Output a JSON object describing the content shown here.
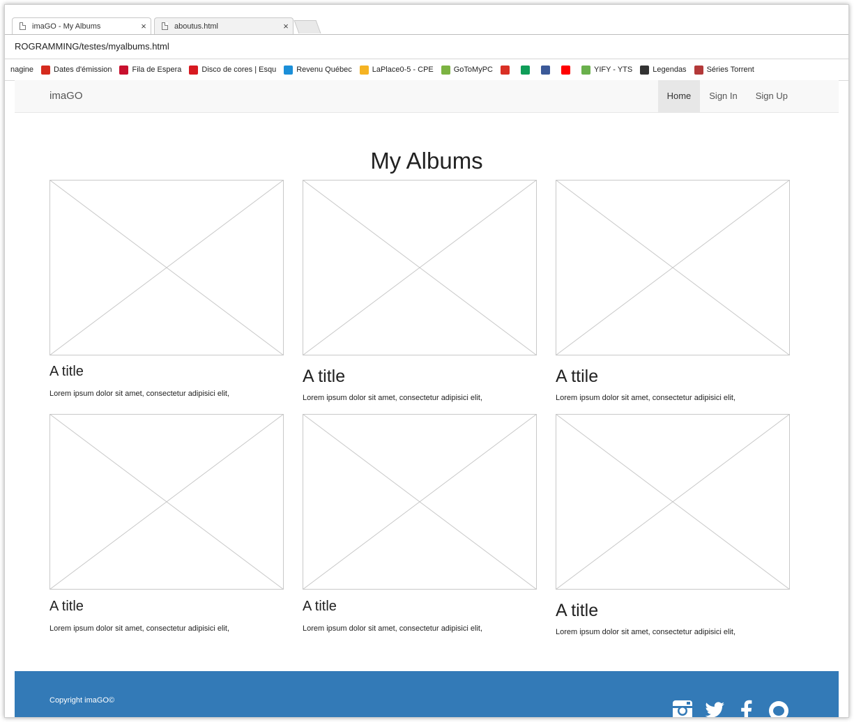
{
  "browser": {
    "tabs": [
      {
        "label": "imaGO - My Albums",
        "close": "×"
      },
      {
        "label": "aboutus.html",
        "close": "×"
      }
    ],
    "address": "ROGRAMMING/testes/myalbums.html",
    "bookmarks": [
      {
        "label": "nagine",
        "color": "#ffffff"
      },
      {
        "label": "Dates d'émission",
        "color": "#d52b1e"
      },
      {
        "label": "Fila de Espera",
        "color": "#c8102e"
      },
      {
        "label": "Disco de cores | Esqu",
        "color": "#d71920"
      },
      {
        "label": "Revenu Québec",
        "color": "#1b8fd8"
      },
      {
        "label": "LaPlace0-5 - CPE",
        "color": "#f5b323"
      },
      {
        "label": "GoToMyPC",
        "color": "#7cb342"
      },
      {
        "label": "",
        "color": "#d93025"
      },
      {
        "label": "",
        "color": "#0f9d58"
      },
      {
        "label": "",
        "color": "#3b5998"
      },
      {
        "label": "",
        "color": "#ff0000"
      },
      {
        "label": "YIFY - YTS",
        "color": "#6ab04c"
      },
      {
        "label": "Legendas",
        "color": "#333333"
      },
      {
        "label": "Séries Torrent",
        "color": "#b33939"
      }
    ]
  },
  "nav": {
    "brand": "imaGO",
    "links": [
      "Home",
      "Sign In",
      "Sign Up"
    ]
  },
  "main": {
    "title": "My Albums",
    "albums": [
      {
        "title": "A title",
        "text": "Lorem ipsum dolor sit amet, consectetur adipisici elit,"
      },
      {
        "title": "A title",
        "text": "Lorem ipsum dolor sit amet, consectetur adipisici elit,"
      },
      {
        "title": "A ttile",
        "text": "Lorem ipsum dolor sit amet, consectetur adipisici elit,"
      },
      {
        "title": "A title",
        "text": "Lorem ipsum dolor sit amet, consectetur adipisici elit,"
      },
      {
        "title": "A title",
        "text": "Lorem ipsum dolor sit amet, consectetur adipisici elit,"
      },
      {
        "title": "A title",
        "text": "Lorem ipsum dolor sit amet, consectetur adipisici elit,"
      }
    ]
  },
  "footer": {
    "copyright": "Copyright imaGO©",
    "social": [
      "instagram-icon",
      "twitter-icon",
      "facebook-icon",
      "github-icon"
    ],
    "color": "#337ab7"
  }
}
